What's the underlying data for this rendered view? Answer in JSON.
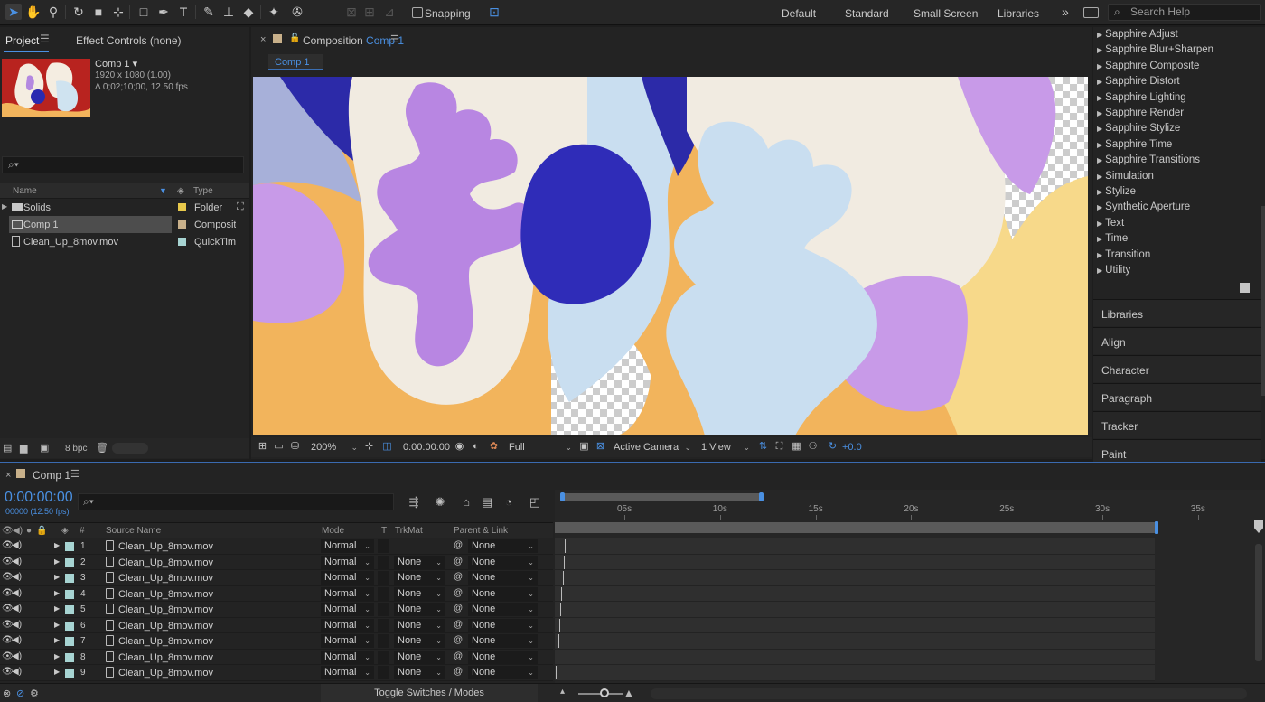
{
  "toolbar": {
    "snapping_label": "Snapping",
    "workspaces": [
      "Default",
      "Standard",
      "Small Screen",
      "Libraries"
    ],
    "more_symbol": "»",
    "search_placeholder": "Search Help"
  },
  "project": {
    "tab_project": "Project",
    "tab_effects": "Effect Controls (none)",
    "comp_name": "Comp 1 ▾",
    "comp_resolution": "1920 x 1080 (1.00)",
    "comp_duration": "Δ 0;02;10;00, 12.50 fps",
    "search_symbol": "⌕▾",
    "col_name": "Name",
    "col_type": "Type",
    "items": [
      {
        "name": "Solids",
        "type": "Folder",
        "label_color": "#e8c94b"
      },
      {
        "name": "Comp 1",
        "type": "Composition",
        "label_color": "#c8b08a"
      },
      {
        "name": "Clean_Up_8mov.mov",
        "type": "QuickTime",
        "label_color": "#a7d4d2"
      }
    ],
    "bpc": "8 bpc"
  },
  "viewer": {
    "title_prefix": "Composition",
    "title_comp": "Comp 1",
    "subtab": "Comp 1",
    "zoom": "200%",
    "timecode": "0:00:00:00",
    "resolution": "Full",
    "camera": "Active Camera",
    "views": "1 View",
    "exposure": "+0.0"
  },
  "effects": {
    "categories": [
      "Sapphire Adjust",
      "Sapphire Blur+Sharpen",
      "Sapphire Composite",
      "Sapphire Distort",
      "Sapphire Lighting",
      "Sapphire Render",
      "Sapphire Stylize",
      "Sapphire Time",
      "Sapphire Transitions",
      "Simulation",
      "Stylize",
      "Synthetic Aperture",
      "Text",
      "Time",
      "Transition",
      "Utility"
    ],
    "panels": [
      "Libraries",
      "Align",
      "Character",
      "Paragraph",
      "Tracker",
      "Paint"
    ]
  },
  "timeline": {
    "tab_title": "Comp 1",
    "timecode": "0:00:00:00",
    "frames": "00000 (12.50 fps)",
    "search_symbol": "⌕▾",
    "columns": {
      "number": "#",
      "source_name": "Source Name",
      "mode": "Mode",
      "t": "T",
      "trkmat": "TrkMat",
      "parent": "Parent & Link"
    },
    "ruler_ticks": [
      "05s",
      "10s",
      "15s",
      "20s",
      "25s",
      "30s",
      "35s"
    ],
    "layers": [
      {
        "num": "1",
        "name": "Clean_Up_8mov.mov",
        "mode": "Normal",
        "trkmat": "",
        "parent": "None"
      },
      {
        "num": "2",
        "name": "Clean_Up_8mov.mov",
        "mode": "Normal",
        "trkmat": "None",
        "parent": "None"
      },
      {
        "num": "3",
        "name": "Clean_Up_8mov.mov",
        "mode": "Normal",
        "trkmat": "None",
        "parent": "None"
      },
      {
        "num": "4",
        "name": "Clean_Up_8mov.mov",
        "mode": "Normal",
        "trkmat": "None",
        "parent": "None"
      },
      {
        "num": "5",
        "name": "Clean_Up_8mov.mov",
        "mode": "Normal",
        "trkmat": "None",
        "parent": "None"
      },
      {
        "num": "6",
        "name": "Clean_Up_8mov.mov",
        "mode": "Normal",
        "trkmat": "None",
        "parent": "None"
      },
      {
        "num": "7",
        "name": "Clean_Up_8mov.mov",
        "mode": "Normal",
        "trkmat": "None",
        "parent": "None"
      },
      {
        "num": "8",
        "name": "Clean_Up_8mov.mov",
        "mode": "Normal",
        "trkmat": "None",
        "parent": "None"
      },
      {
        "num": "9",
        "name": "Clean_Up_8mov.mov",
        "mode": "Normal",
        "trkmat": "None",
        "parent": "None"
      }
    ],
    "toggle_label": "Toggle Switches / Modes"
  },
  "colors": {
    "accent": "#4a90e2",
    "layer_label": "#a7d4d2"
  }
}
